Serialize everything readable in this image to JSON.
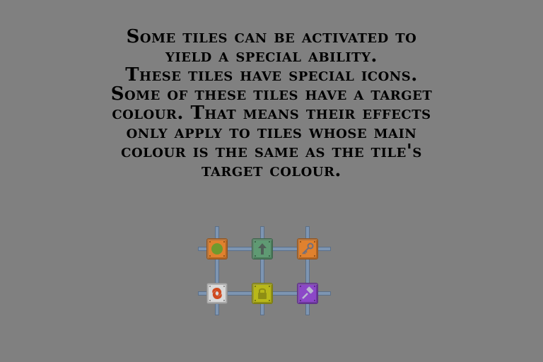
{
  "tutorial": {
    "lines": [
      "Some tiles can be activated to",
      "yield a special ability.",
      "These tiles have special icons.",
      "Some of these tiles have a target",
      "colour. That means their effects",
      "only apply to tiles whose main",
      "colour is the same as the tile's",
      "target colour."
    ]
  },
  "board": {
    "tiles": [
      {
        "color": "#e0812e",
        "icon": "green-orb-icon",
        "icon_color": "#6f9a2e"
      },
      {
        "color": "#5f9a73",
        "icon": "arrow-up-icon",
        "icon_color": "#4f5f57"
      },
      {
        "color": "#e0812e",
        "icon": "key-icon",
        "icon_color": "#6f6f7f"
      },
      {
        "color": "#d9d9d9",
        "icon": "swirl-icon",
        "icon_color": "#cf4a1f"
      },
      {
        "color": "#b8b81a",
        "icon": "padlock-icon",
        "icon_color": "#8e8e14"
      },
      {
        "color": "#8c48c8",
        "icon": "hammer-icon",
        "icon_color": "#b9b9d0"
      }
    ]
  }
}
